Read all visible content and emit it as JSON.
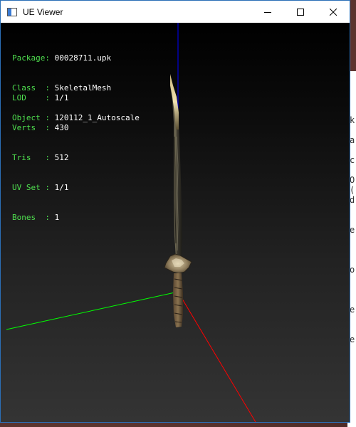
{
  "window": {
    "title": "UE Viewer",
    "buttons": {
      "minimize": "minimize-icon",
      "maximize": "maximize-icon",
      "close": "close-icon"
    }
  },
  "info_block_1": [
    {
      "label": "Package",
      "sep": ": ",
      "value": "00028711.upk"
    },
    {
      "label": "Class  ",
      "sep": ": ",
      "value": "SkeletalMesh"
    },
    {
      "label": "Object ",
      "sep": ": ",
      "value": "120112_1_Autoscale"
    }
  ],
  "info_block_2": [
    {
      "label": "LOD    ",
      "sep": ": ",
      "value": "1/1"
    },
    {
      "label": "Verts  ",
      "sep": ": ",
      "value": "430"
    },
    {
      "label": "Tris   ",
      "sep": ": ",
      "value": "512"
    },
    {
      "label": "UV Set ",
      "sep": ": ",
      "value": "1/1"
    },
    {
      "label": "Bones  ",
      "sep": ": ",
      "value": "1"
    }
  ],
  "background_text": [
    "k",
    "a",
    "c",
    "O",
    "(",
    "d",
    "e",
    "o",
    "e",
    "e"
  ],
  "colors": {
    "label_green": "#4fe04f",
    "value_white": "#ffffff",
    "axis_x": "#ff0000",
    "axis_y": "#00ff00",
    "axis_z": "#0000ff",
    "window_border": "#2b6fb7"
  }
}
